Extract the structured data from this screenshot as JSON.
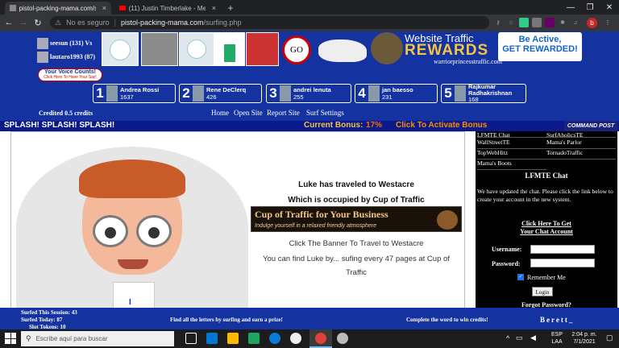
{
  "browser": {
    "tabs": [
      {
        "label": "pistol-packing-mama.com/surfi",
        "close": "×"
      },
      {
        "label": "(11) Justin Timberlake - Mec",
        "close": "×"
      }
    ],
    "new_tab": "+",
    "security_label": "No es seguro",
    "url_host": "pistol-packing-mama.com",
    "url_path": "/surfing.php",
    "profile_initial": "b"
  },
  "header": {
    "user_line1": "seesun (131) Vs",
    "user_line2": "lautaro1993 (87)",
    "go_label": "GO",
    "ad_title": "Website Traffic",
    "ad_rewards": "REWARDS",
    "ad_be_active": "Be Active,",
    "ad_get_rewarded": "GET REWARDED!",
    "ad_domain": "warriorprincesstraffic.com",
    "voice_title": "Your Voice Counts!",
    "voice_sub": "Click Here To Have Your Say!",
    "credited": "Credited 0.5 credits"
  },
  "ranks": [
    {
      "num": "1",
      "name": "Andrea Rossi",
      "score": "1637"
    },
    {
      "num": "2",
      "name": "Rene DeClerq",
      "score": "426"
    },
    {
      "num": "3",
      "name": "andrei lenuta",
      "score": "255"
    },
    {
      "num": "4",
      "name": "jan baesso",
      "score": "231"
    },
    {
      "num": "5",
      "name": "Rajkumar Radhakrishnan",
      "score": "168"
    }
  ],
  "nav": {
    "home": "Home",
    "open_site": "Open Site",
    "report_site": "Report Site",
    "surf_settings": "Surf Settings"
  },
  "splash": {
    "text": "SPLASH! SPLASH! SPLASH!",
    "bonus_label": "Current Bonus:",
    "bonus_value": "17%",
    "activate": "Click To Activate Bonus",
    "command_post": "COMMAND POST"
  },
  "main": {
    "travel_title": "Luke has traveled to Westacre",
    "occupied": "Which is occupied by Cup of Traffic",
    "banner_title": "Cup of Traffic for Your Business",
    "banner_sub": "Indulge yourself in a relaxed friendly atmosphere",
    "click_banner": "Click The Banner To Travel to Westacre",
    "find_luke": "You can find Luke by... sufing every 47 pages at Cup of",
    "find_luke2": "Traffic",
    "avatar_letter": "I"
  },
  "sidebar": {
    "links": [
      "LFMTE Chat",
      "SurfAholicsTE",
      "WallStreetTE",
      "Mama's Parlor",
      "TopWebHitz",
      "TornadoTraffic",
      "Mama's Boots"
    ],
    "chat_title": "LFMTE Chat",
    "chat_msg": "We have updated the chat. Please click the link below to create your account in the new system.",
    "create_link1": "Click Here To Get",
    "create_link2": "Your Chat Account",
    "username_label": "Username:",
    "password_label": "Password:",
    "remember": "Remember Me",
    "login": "Login",
    "forgot": "Forgot Password?"
  },
  "footer": {
    "surfed_session": "Surfed This Session: 43",
    "surfed_today": "Surfed Today: 87",
    "slot_tokens": "Slot Tokens: 10",
    "letters": "Find all the letters by surfing and earn a prize!",
    "complete": "Complete the word to win credits!",
    "word": "Berett_"
  },
  "taskbar": {
    "search_placeholder": "Escribe aquí para buscar",
    "lang1": "ESP",
    "lang2": "LAA",
    "time": "2:04 p. m.",
    "date": "7/1/2021"
  }
}
